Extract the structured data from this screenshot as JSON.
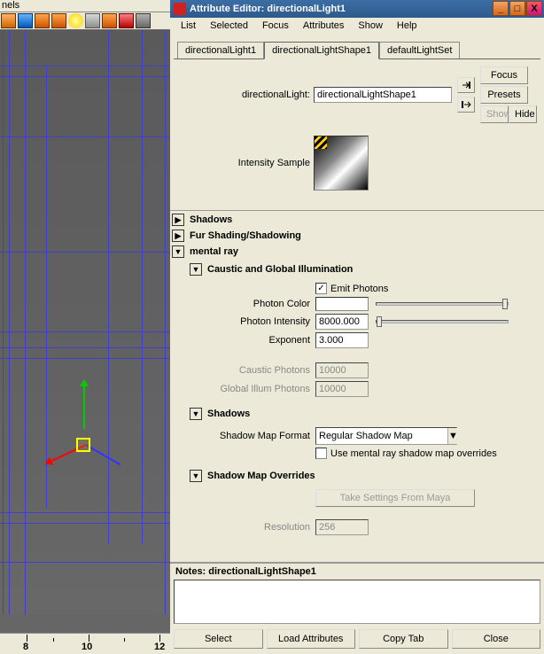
{
  "left": {
    "titlebar": "nels",
    "ruler": {
      "a": "8",
      "b": "10",
      "c": "12"
    }
  },
  "window": {
    "title": "Attribute Editor: directionalLight1",
    "min": "_",
    "max": "□",
    "close": "X"
  },
  "menus": {
    "list": "List",
    "selected": "Selected",
    "focus": "Focus",
    "attributes": "Attributes",
    "show": "Show",
    "help": "Help"
  },
  "tabs": {
    "t1": "directionalLight1",
    "t2": "directionalLightShape1",
    "t3": "defaultLightSet"
  },
  "header": {
    "label": "directionalLight:",
    "value": "directionalLightShape1",
    "focus": "Focus",
    "presets": "Presets",
    "show": "Show",
    "hide": "Hide"
  },
  "sample": {
    "label": "Intensity Sample"
  },
  "sections": {
    "shadows": "Shadows",
    "fur": "Fur Shading/Shadowing",
    "mental": "mental ray",
    "caustic": "Caustic and Global Illumination",
    "shadows2": "Shadows",
    "overrides": "Shadow Map Overrides"
  },
  "fields": {
    "emit": "Emit Photons",
    "photonColorLbl": "Photon Color",
    "photonIntensityLbl": "Photon Intensity",
    "photonIntensityVal": "8000.000",
    "exponentLbl": "Exponent",
    "exponentVal": "3.000",
    "causticLbl": "Caustic Photons",
    "causticVal": "10000",
    "giLbl": "Global Illum Photons",
    "giVal": "10000",
    "mapFormatLbl": "Shadow Map Format",
    "mapFormatVal": "Regular Shadow Map",
    "useOverrides": "Use mental ray shadow map overrides",
    "takeFromMaya": "Take Settings From Maya",
    "resolutionLbl": "Resolution",
    "resolutionVal": "256"
  },
  "notes": {
    "label": "Notes:  directionalLightShape1"
  },
  "buttons": {
    "select": "Select",
    "load": "Load Attributes",
    "copy": "Copy Tab",
    "close": "Close"
  }
}
